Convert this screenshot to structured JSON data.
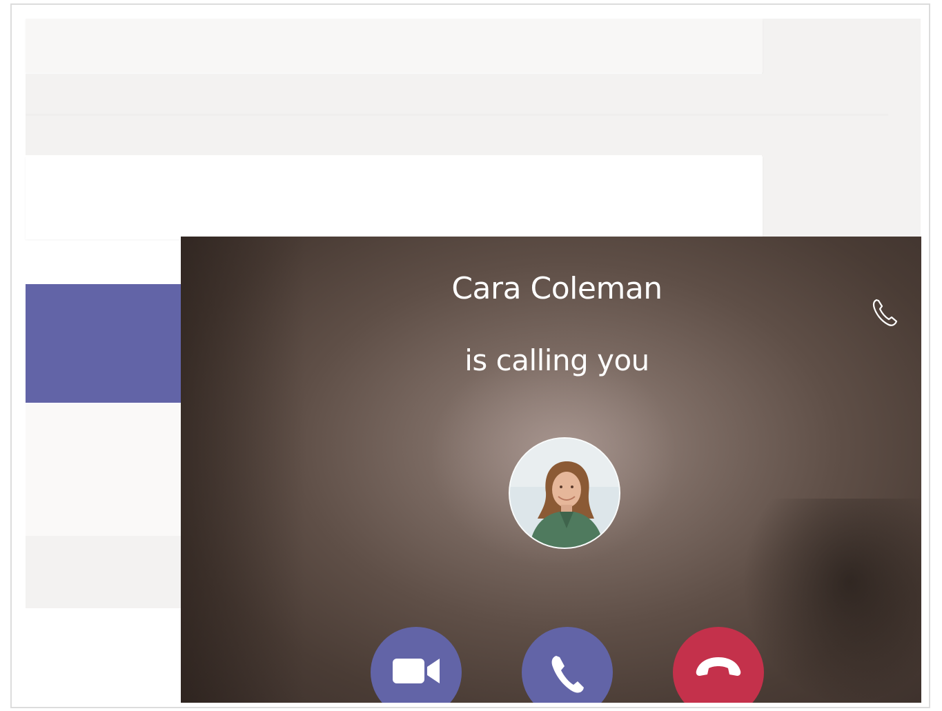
{
  "incoming_call": {
    "caller_name": "Cara Coleman",
    "status_text": "is calling you",
    "caller_avatar": "caller-photo",
    "corner_icon": "phone-icon",
    "actions": [
      {
        "name": "accept-video-button",
        "icon": "video-camera-icon",
        "color": "#6264a7"
      },
      {
        "name": "accept-audio-button",
        "icon": "phone-icon",
        "color": "#6264a7"
      },
      {
        "name": "decline-button",
        "icon": "hang-up-icon",
        "color": "#c4314b"
      }
    ]
  },
  "theme": {
    "accent": "#6264a7",
    "decline": "#c4314b"
  }
}
